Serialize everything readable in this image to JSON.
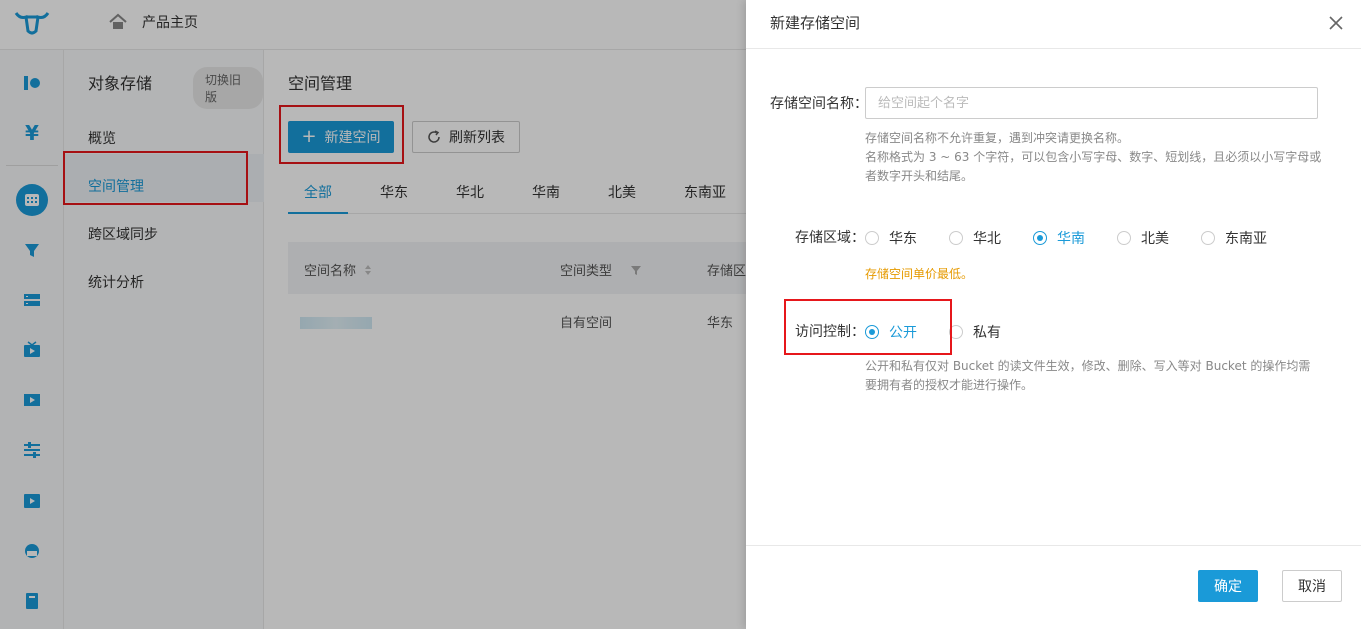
{
  "header": {
    "home_label": "产品主页"
  },
  "icon_sidebar": [
    "fusion-icon",
    "billing-icon",
    "storage-icon",
    "cdn-icon",
    "server-icon",
    "live-icon",
    "video-icon",
    "settings-icon",
    "media-icon",
    "chat-icon",
    "docs-icon"
  ],
  "subnav": {
    "title": "对象存储",
    "switch_label": "切换旧版",
    "items": [
      {
        "label": "概览"
      },
      {
        "label": "空间管理"
      },
      {
        "label": "跨区域同步"
      },
      {
        "label": "统计分析"
      }
    ]
  },
  "main": {
    "title": "空间管理",
    "new_button": "新建空间",
    "refresh_button": "刷新列表",
    "tabs": [
      "全部",
      "华东",
      "华北",
      "华南",
      "北美",
      "东南亚"
    ],
    "columns": [
      "空间名称",
      "空间类型",
      "存储区"
    ],
    "row": {
      "type": "自有空间",
      "region": "华东"
    }
  },
  "drawer": {
    "title": "新建存储空间",
    "name_label": "存储空间名称：",
    "name_placeholder": "给空间起个名字",
    "name_hint_1": "存储空间名称不允许重复，遇到冲突请更换名称。",
    "name_hint_2": "名称格式为 3 ~ 63 个字符，可以包含小写字母、数字、短划线，且必须以小写字母或者数字开头和结尾。",
    "region_label": "存储区域：",
    "regions": [
      "华东",
      "华北",
      "华南",
      "北美",
      "东南亚"
    ],
    "selected_region": "华南",
    "region_hint": "存储空间单价最低。",
    "access_label": "访问控制：",
    "access_options": [
      "公开",
      "私有"
    ],
    "selected_access": "公开",
    "access_hint": "公开和私有仅对 Bucket 的读文件生效，修改、删除、写入等对 Bucket 的操作均需要拥有者的授权才能进行操作。",
    "ok_label": "确定",
    "cancel_label": "取消"
  },
  "colors": {
    "accent": "#1a9ad8",
    "highlight_box": "#e6171b",
    "warning": "#e69a00"
  }
}
